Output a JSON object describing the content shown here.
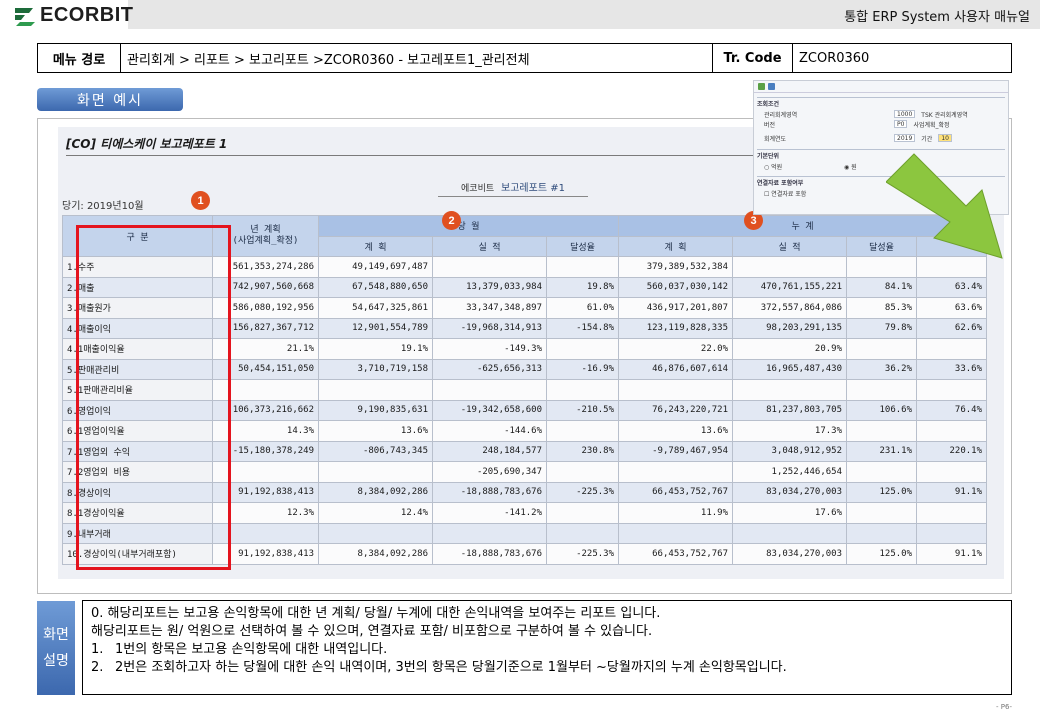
{
  "header": {
    "logo_text": "ECORBIT",
    "manual_title": "통합 ERP System 사용자 매뉴얼"
  },
  "menu": {
    "path_label": "메뉴 경로",
    "path_value": "관리회계 > 리포트 > 보고리포트 >ZCOR0360 - 보고레포트1_관리전체",
    "code_label": "Tr. Code",
    "code_value": "ZCOR0360"
  },
  "screen_example_label": "화면 예시",
  "report": {
    "title": "[CO] 티에스케이 보고레포트 1",
    "period": "당기: 2019년10월",
    "center_title_prefix": "에코비트",
    "center_title_main": "보고레포트 #1",
    "headers": {
      "category": "구 분",
      "annual_plan_1": "년 계획",
      "annual_plan_2": "(사업계획_확정)",
      "month_group": "당 월",
      "cumul_group": "누 계",
      "plan": "계 획",
      "actual": "실 적",
      "rate": "달성율"
    },
    "rows": [
      {
        "label": "1.수주",
        "annual": "561,353,274,286",
        "m_plan": "49,149,697,487",
        "m_actual": "",
        "m_rate": "",
        "c_plan": "379,389,532,384",
        "c_actual": "",
        "c_rate": "",
        "c_extra": ""
      },
      {
        "label": "2.매출",
        "annual": "742,907,560,668",
        "m_plan": "67,548,880,650",
        "m_actual": "13,379,033,984",
        "m_rate": "19.8%",
        "c_plan": "560,037,030,142",
        "c_actual": "470,761,155,221",
        "c_rate": "84.1%",
        "c_extra": "63.4%"
      },
      {
        "label": "3.매출원가",
        "annual": "586,080,192,956",
        "m_plan": "54,647,325,861",
        "m_actual": "33,347,348,897",
        "m_rate": "61.0%",
        "c_plan": "436,917,201,807",
        "c_actual": "372,557,864,086",
        "c_rate": "85.3%",
        "c_extra": "63.6%"
      },
      {
        "label": "4.매출이익",
        "annual": "156,827,367,712",
        "m_plan": "12,901,554,789",
        "m_actual": "-19,968,314,913",
        "m_rate": "-154.8%",
        "c_plan": "123,119,828,335",
        "c_actual": "98,203,291,135",
        "c_rate": "79.8%",
        "c_extra": "62.6%"
      },
      {
        "label": "4.1매출이익율",
        "annual": "21.1%",
        "m_plan": "19.1%",
        "m_actual": "-149.3%",
        "m_rate": "",
        "c_plan": "22.0%",
        "c_actual": "20.9%",
        "c_rate": "",
        "c_extra": ""
      },
      {
        "label": "5.판매관리비",
        "annual": "50,454,151,050",
        "m_plan": "3,710,719,158",
        "m_actual": "-625,656,313",
        "m_rate": "-16.9%",
        "c_plan": "46,876,607,614",
        "c_actual": "16,965,487,430",
        "c_rate": "36.2%",
        "c_extra": "33.6%"
      },
      {
        "label": "5.1판매관리비율",
        "annual": "",
        "m_plan": "",
        "m_actual": "",
        "m_rate": "",
        "c_plan": "",
        "c_actual": "",
        "c_rate": "",
        "c_extra": ""
      },
      {
        "label": "6.영업이익",
        "annual": "106,373,216,662",
        "m_plan": "9,190,835,631",
        "m_actual": "-19,342,658,600",
        "m_rate": "-210.5%",
        "c_plan": "76,243,220,721",
        "c_actual": "81,237,803,705",
        "c_rate": "106.6%",
        "c_extra": "76.4%"
      },
      {
        "label": "6.1영업이익율",
        "annual": "14.3%",
        "m_plan": "13.6%",
        "m_actual": "-144.6%",
        "m_rate": "",
        "c_plan": "13.6%",
        "c_actual": "17.3%",
        "c_rate": "",
        "c_extra": ""
      },
      {
        "label": "7.1영업외 수익",
        "annual": "-15,180,378,249",
        "m_plan": "-806,743,345",
        "m_actual": "248,184,577",
        "m_rate": "230.8%",
        "c_plan": "-9,789,467,954",
        "c_actual": "3,048,912,952",
        "c_rate": "231.1%",
        "c_extra": "220.1%"
      },
      {
        "label": "7.2영업외 비용",
        "annual": "",
        "m_plan": "",
        "m_actual": "-205,690,347",
        "m_rate": "",
        "c_plan": "",
        "c_actual": "1,252,446,654",
        "c_rate": "",
        "c_extra": ""
      },
      {
        "label": "8.경상이익",
        "annual": "91,192,838,413",
        "m_plan": "8,384,092,286",
        "m_actual": "-18,888,783,676",
        "m_rate": "-225.3%",
        "c_plan": "66,453,752,767",
        "c_actual": "83,034,270,003",
        "c_rate": "125.0%",
        "c_extra": "91.1%"
      },
      {
        "label": "8.1경상이익율",
        "annual": "12.3%",
        "m_plan": "12.4%",
        "m_actual": "-141.2%",
        "m_rate": "",
        "c_plan": "11.9%",
        "c_actual": "17.6%",
        "c_rate": "",
        "c_extra": ""
      },
      {
        "label": "9.내부거래",
        "annual": "",
        "m_plan": "",
        "m_actual": "",
        "m_rate": "",
        "c_plan": "",
        "c_actual": "",
        "c_rate": "",
        "c_extra": ""
      },
      {
        "label": "10.경상이익(내부거래포함)",
        "annual": "91,192,838,413",
        "m_plan": "8,384,092,286",
        "m_actual": "-18,888,783,676",
        "m_rate": "-225.3%",
        "c_plan": "66,453,752,767",
        "c_actual": "83,034,270,003",
        "c_rate": "125.0%",
        "c_extra": "91.1%"
      }
    ],
    "badges": [
      "1",
      "2",
      "3"
    ]
  },
  "popup": {
    "section1": "조회조건",
    "rows1": [
      {
        "key": "관리회계영역",
        "value": "1000",
        "text": "TSK 관리회계영역"
      },
      {
        "key": "버전",
        "value": "P0",
        "text": "사업계획_확정"
      }
    ],
    "fiscal_year_label": "회계연도",
    "fiscal_year": "2019",
    "period_label": "기간",
    "period_value": "10",
    "section2": "기본단위",
    "unit_opt1": "억원",
    "unit_opt2": "원",
    "section3": "연결자료 포함여부",
    "include_label": "연결자료 포함"
  },
  "explanation": {
    "tag_1": "화면",
    "tag_2": "설명",
    "line0": "0. 해당리포트는  보고용 손익항목에 대한 년 계획/ 당월/ 누계에 대한 손익내역을 보여주는 리포트 입니다.",
    "line0b": "해당리포트는 원/ 억원으로 선택하여 볼 수 있으며, 연결자료 포함/ 비포함으로 구분하여 볼 수 있습니다.",
    "items": [
      {
        "n": "1.",
        "text": "1번의 항목은 보고용 손익항목에 대한 내역입니다."
      },
      {
        "n": "2.",
        "text": "2번은 조회하고자 하는 당월에 대한 손익 내역이며, 3번의 항목은 당월기준으로 1월부터 ~당월까지의 누계 손익항목입니다."
      }
    ]
  },
  "page_number": "- P6-",
  "colors": {
    "accent_blue": "#3c68ae",
    "highlight_red": "#e4141e",
    "arrow_green": "#8cc63f",
    "badge_orange": "#e05020"
  }
}
